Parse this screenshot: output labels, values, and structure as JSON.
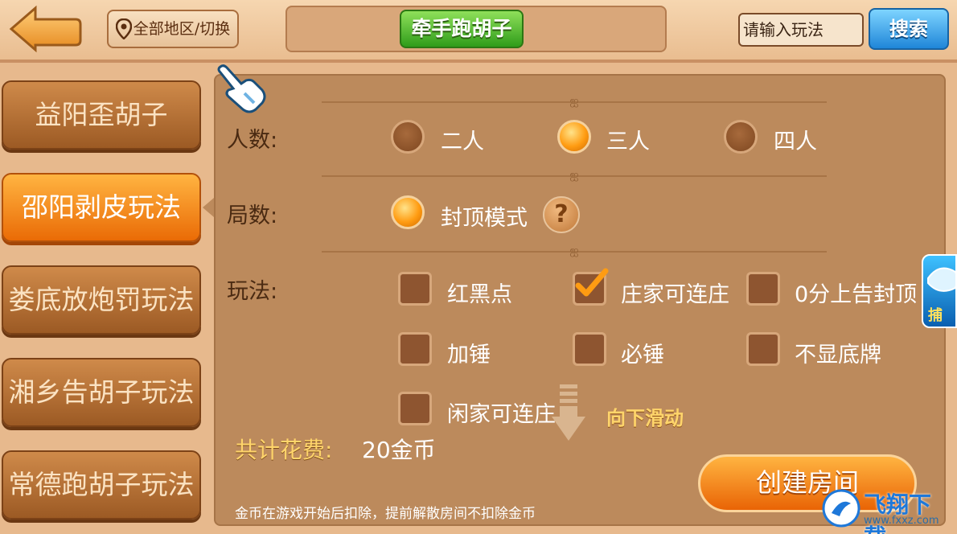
{
  "header": {
    "region_button": "全部地区/切换",
    "game_title": "牵手跑胡子",
    "search_placeholder": "请输入玩法",
    "search_button": "搜索"
  },
  "sidebar": {
    "items": [
      {
        "label": "益阳歪胡子",
        "active": false
      },
      {
        "label": "邵阳剥皮玩法",
        "active": true
      },
      {
        "label": "娄底放炮罚玩法",
        "active": false
      },
      {
        "label": "湘乡告胡子玩法",
        "active": false
      },
      {
        "label": "常德跑胡子玩法",
        "active": false
      }
    ]
  },
  "rules": {
    "players": {
      "label": "人数:",
      "options": [
        {
          "label": "二人",
          "selected": false
        },
        {
          "label": "三人",
          "selected": true
        },
        {
          "label": "四人",
          "selected": false
        }
      ]
    },
    "rounds": {
      "label": "局数:",
      "options": [
        {
          "label": "封顶模式",
          "selected": true
        }
      ]
    },
    "play": {
      "label": "玩法:",
      "options": [
        {
          "label": "红黑点",
          "checked": false
        },
        {
          "label": "庄家可连庄",
          "checked": true
        },
        {
          "label": "0分上告封顶",
          "checked": false
        },
        {
          "label": "加锤",
          "checked": false
        },
        {
          "label": "必锤",
          "checked": false
        },
        {
          "label": "不显底牌",
          "checked": false
        },
        {
          "label": "闲家可连庄",
          "checked": false
        }
      ]
    }
  },
  "scroll_hint": "向下滑动",
  "cost": {
    "label": "共计花费:",
    "value": "20金币"
  },
  "notice": "金币在游戏开始后扣除，提前解散房间不扣除金币",
  "create_button": "创建房间",
  "side_promo": "捕鱼",
  "watermark": {
    "name": "飞翔下载",
    "url": "www.fxxz.com"
  },
  "colors": {
    "background": "#e7b98d",
    "panel": "#bc8a5c",
    "accent_orange": "#ea6b06",
    "accent_green": "#2f9c1a",
    "accent_blue": "#1f86d8",
    "cost_yellow": "#ffd56b"
  },
  "icons": [
    "back-arrow-icon",
    "location-pin-icon",
    "hand-pointer-icon",
    "question-icon",
    "checkmark-icon",
    "arrow-down-icon",
    "fish-game-icon",
    "watermark-logo-icon"
  ]
}
